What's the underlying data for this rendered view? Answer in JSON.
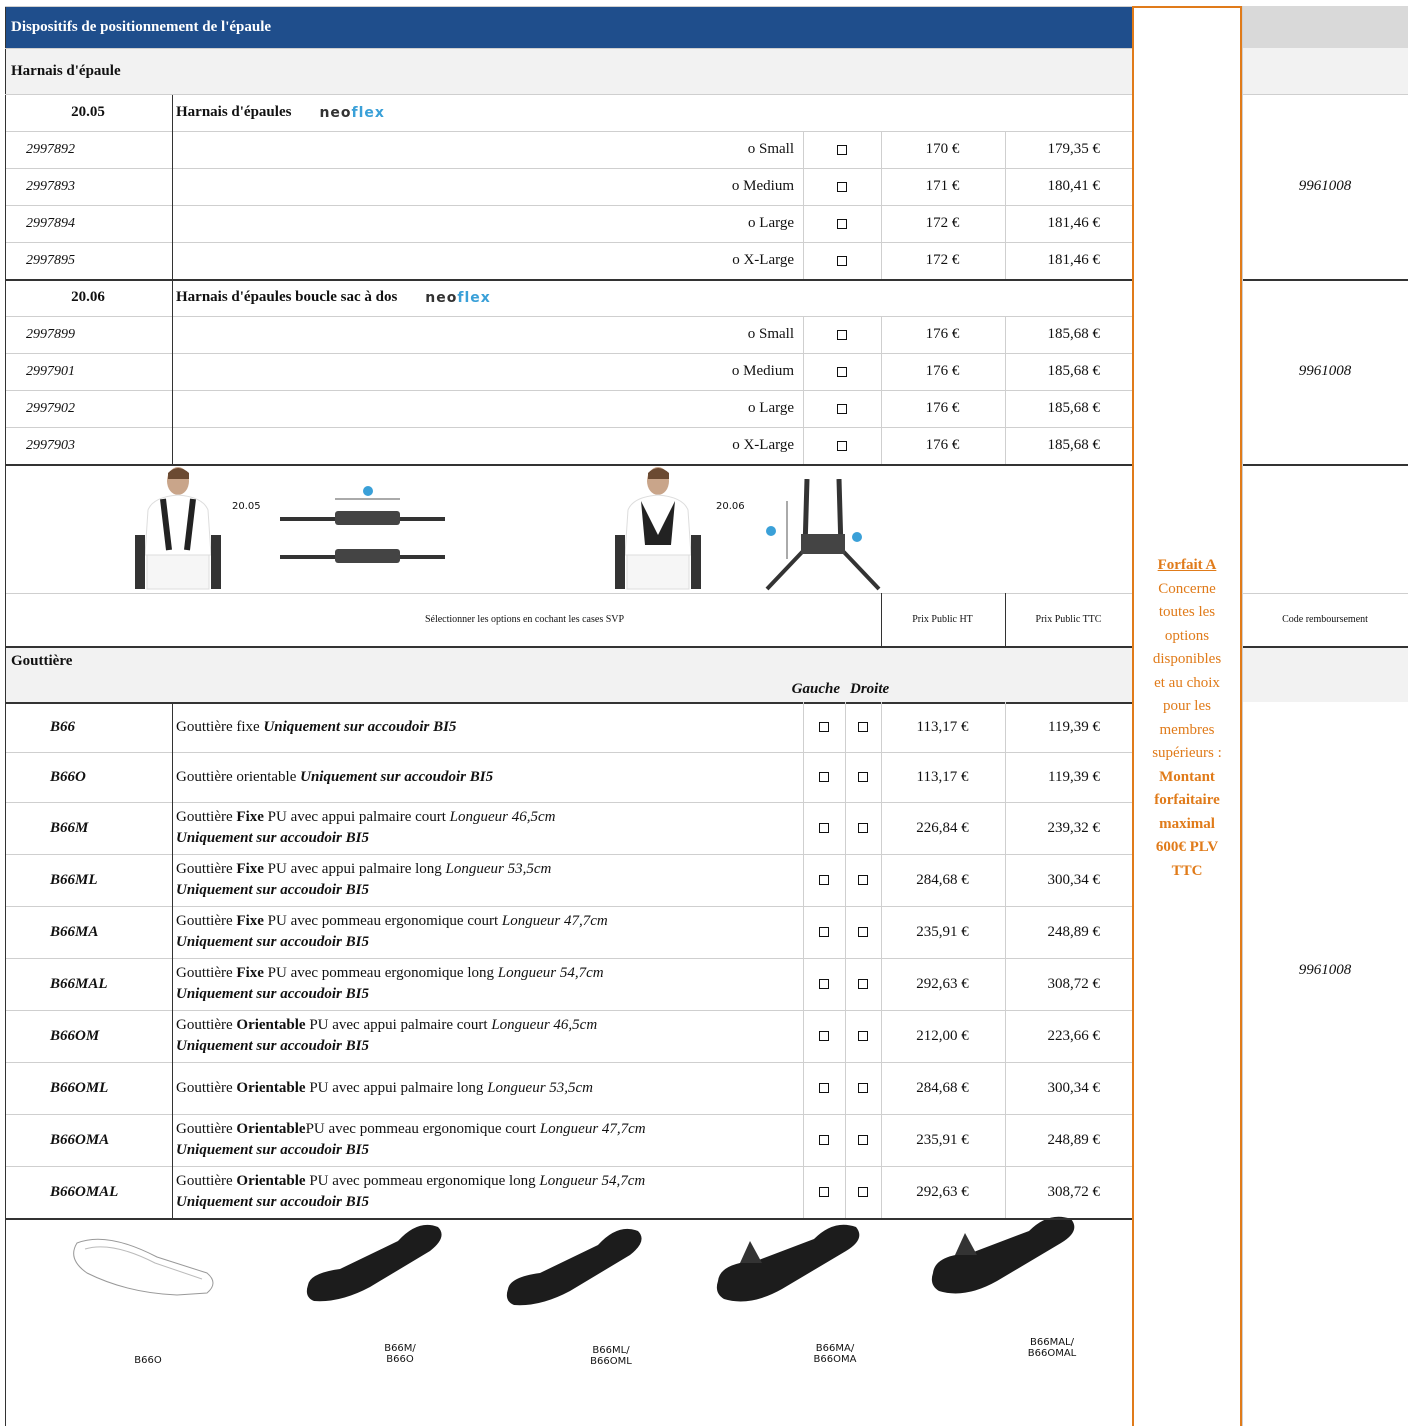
{
  "title": "Dispositifs de positionnement de l'épaule",
  "harness_section": "Harnais d'épaule",
  "brand": {
    "part1": "neo",
    "part2": "flex"
  },
  "products": [
    {
      "ref": "20.05",
      "name": "Harnais d'épaules",
      "code": "9961008",
      "items": [
        {
          "sku": "2997892",
          "size": "o Small",
          "ht": "170 €",
          "ttc": "179,35 €"
        },
        {
          "sku": "2997893",
          "size": "o Medium",
          "ht": "171 €",
          "ttc": "180,41 €"
        },
        {
          "sku": "2997894",
          "size": "o Large",
          "ht": "172 €",
          "ttc": "181,46 €"
        },
        {
          "sku": "2997895",
          "size": "o X-Large",
          "ht": "172 €",
          "ttc": "181,46 €"
        }
      ]
    },
    {
      "ref": "20.06",
      "name": "Harnais d'épaules boucle sac à dos",
      "code": "9961008",
      "items": [
        {
          "sku": "2997899",
          "size": "o Small",
          "ht": "176 €",
          "ttc": "185,68 €"
        },
        {
          "sku": "2997901",
          "size": "o Medium",
          "ht": "176 €",
          "ttc": "185,68 €"
        },
        {
          "sku": "2997902",
          "size": "o Large",
          "ht": "176 €",
          "ttc": "185,68 €"
        },
        {
          "sku": "2997903",
          "size": "o X-Large",
          "ht": "176 €",
          "ttc": "185,68 €"
        }
      ]
    }
  ],
  "image_labels": {
    "a": "20.05",
    "b": "20.06"
  },
  "header_row": {
    "select": "Sélectionner les options en cochant les cases SVP",
    "ht": "Prix Public HT",
    "ttc": "Prix Public TTC",
    "code": "Code remboursement"
  },
  "gutter_section": "Gouttière",
  "side_headers": {
    "left": "Gauche",
    "right": "Droite"
  },
  "gutter_code": "9961008",
  "gutters": [
    {
      "ref": "B66",
      "pre": "Gouttière fixe ",
      "strong": "",
      "mid": "",
      "len": "",
      "only": "Uniquement sur accoudoir BI5",
      "inline": true,
      "ht": "113,17 €",
      "ttc": "119,39 €"
    },
    {
      "ref": "B66O",
      "pre": "Gouttière orientable ",
      "strong": "",
      "mid": "",
      "len": "",
      "only": "Uniquement sur accoudoir BI5",
      "inline": true,
      "ht": "113,17 €",
      "ttc": "119,39 €"
    },
    {
      "ref": "B66M",
      "pre": "Gouttière ",
      "strong": "Fixe",
      "mid": " PU avec appui palmaire court ",
      "len": "Longueur 46,5cm",
      "only": "Uniquement sur accoudoir BI5",
      "inline": false,
      "ht": "226,84 €",
      "ttc": "239,32 €"
    },
    {
      "ref": "B66ML",
      "pre": "Gouttière ",
      "strong": "Fixe",
      "mid": " PU avec appui palmaire long ",
      "len": "Longueur 53,5cm",
      "only": "Uniquement sur accoudoir BI5",
      "inline": false,
      "ht": "284,68 €",
      "ttc": "300,34 €"
    },
    {
      "ref": "B66MA",
      "pre": "Gouttière ",
      "strong": "Fixe",
      "mid": " PU avec pommeau ergonomique court ",
      "len": "Longueur 47,7cm",
      "only": "Uniquement sur accoudoir BI5",
      "inline": false,
      "ht": "235,91 €",
      "ttc": "248,89 €"
    },
    {
      "ref": "B66MAL",
      "pre": "Gouttière ",
      "strong": "Fixe",
      "mid": " PU avec pommeau ergonomique long ",
      "len": "Longueur 54,7cm",
      "only": "Uniquement sur accoudoir BI5",
      "inline": false,
      "ht": "292,63 €",
      "ttc": "308,72 €"
    },
    {
      "ref": "B66OM",
      "pre": "Gouttière ",
      "strong": "Orientable",
      "mid": " PU avec appui palmaire court ",
      "len": "Longueur 46,5cm",
      "only": "Uniquement sur accoudoir BI5",
      "inline": false,
      "ht": "212,00 €",
      "ttc": "223,66 €"
    },
    {
      "ref": "B66OML",
      "pre": "Gouttière ",
      "strong": "Orientable",
      "mid": " PU avec appui palmaire long ",
      "len": "Longueur 53,5cm",
      "only": "",
      "inline": false,
      "ht": "284,68 €",
      "ttc": "300,34 €"
    },
    {
      "ref": "B66OMA",
      "pre": "Gouttière ",
      "strong": "Orientable",
      "mid": "PU avec pommeau ergonomique court ",
      "len": "Longueur 47,7cm",
      "only": "Uniquement sur accoudoir BI5",
      "inline": false,
      "ht": "235,91 €",
      "ttc": "248,89 €"
    },
    {
      "ref": "B66OMAL",
      "pre": "Gouttière ",
      "strong": "Orientable",
      "mid": " PU avec pommeau ergonomique long ",
      "len": "Longueur 54,7cm",
      "only": "Uniquement sur accoudoir BI5",
      "inline": false,
      "ht": "292,63 €",
      "ttc": "308,72 €"
    }
  ],
  "gutter_images": [
    {
      "l1": "B66O",
      "l2": ""
    },
    {
      "l1": "B66M/",
      "l2": "B66O"
    },
    {
      "l1": "B66ML/",
      "l2": "B66OML"
    },
    {
      "l1": "B66MA/",
      "l2": "B66OMA"
    },
    {
      "l1": "B66MAL/",
      "l2": "B66OMAL"
    }
  ],
  "forfait": {
    "title": "Forfait A",
    "lines": [
      "Concerne",
      "toutes les",
      "options",
      "disponibles",
      "et au choix",
      "pour les",
      "membres",
      "supérieurs :"
    ],
    "bold_lines": [
      "Montant",
      "forfaitaire",
      "maximal",
      "600€ PLV",
      "TTC"
    ]
  },
  "colors": {
    "header_bg": "#1f4e8c",
    "forfait": "#e07b1a",
    "section_bg": "#f2f2f2"
  }
}
